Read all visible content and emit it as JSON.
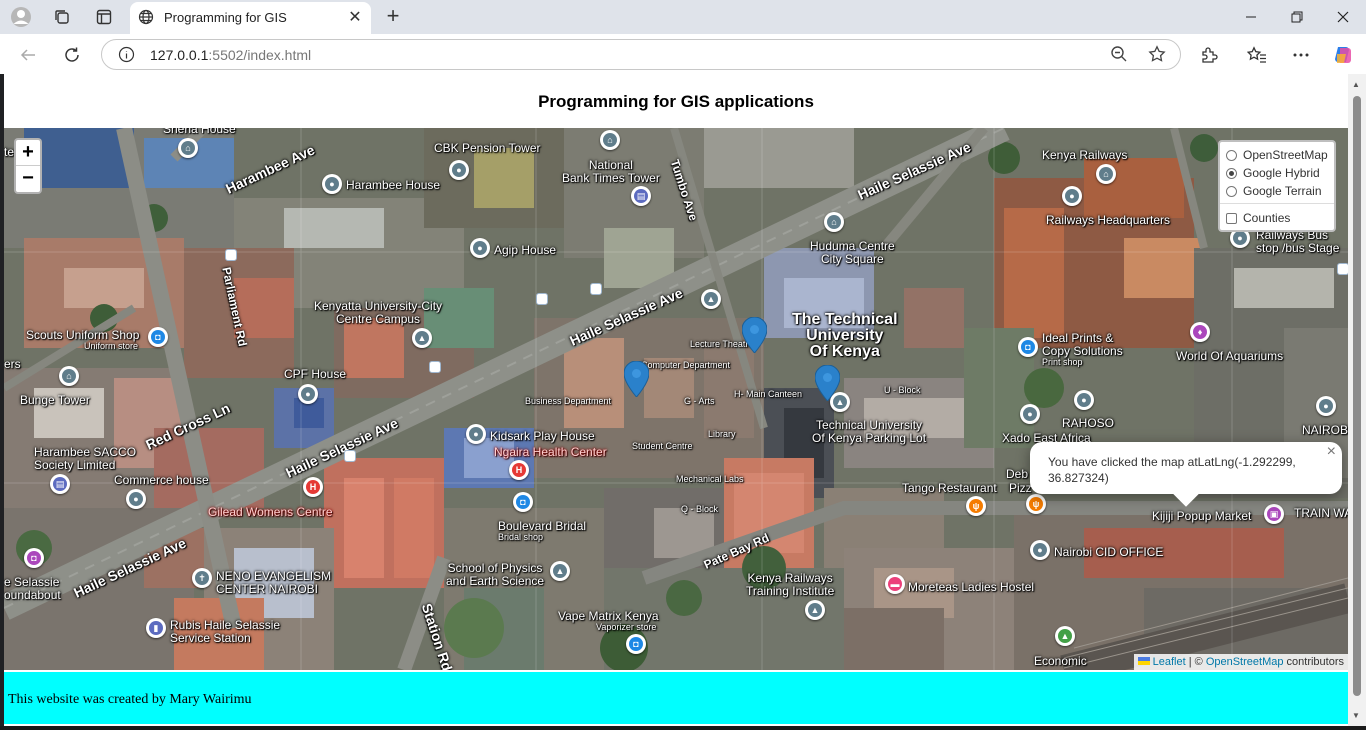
{
  "browser": {
    "tab_title": "Programming for GIS",
    "url_host": "127.0.0.1",
    "url_rest": ":5502/index.html"
  },
  "page": {
    "title": "Programming for GIS applications",
    "footer": "This website was created by Mary Wairimu"
  },
  "map": {
    "zoom_in": "+",
    "zoom_out": "−",
    "layers": {
      "base": [
        "OpenStreetMap",
        "Google Hybrid",
        "Google Terrain"
      ],
      "selected": "Google Hybrid",
      "overlays": [
        "Counties"
      ]
    },
    "popup": {
      "text": "You have clicked the map atLatLng(-1.292299, 36.827324)",
      "close": "×"
    },
    "attribution": {
      "leaflet": "Leaflet",
      "separator": " | © ",
      "osm": "OpenStreetMap",
      "suffix": " contributors"
    },
    "labels": {
      "sheria_house": "Sheria House",
      "cbk_pension": "CBK Pension Tower",
      "tumbo_ave": "Tumbo Ave",
      "national_bank": "National\nBank Times Tower",
      "kenya_railways": "Kenya Railways",
      "haile_selassie_ave_1": "Haile Selassie Ave",
      "harambee_ave": "Harambee Ave",
      "harambee_house": "Harambee House",
      "agip_house": "Agip House",
      "huduma_centre": "Huduma Centre\nCity Square",
      "railways_hq": "Railways Headquarters",
      "railways_bus": "Railways Bus\nstop /bus Stage",
      "parliament_rd": "Parliament Rd",
      "kenyatta_univ": "Kenyatta University-City\nCentre Campus",
      "haile_selassie_ave_2": "Haile Selassie Ave",
      "tuk": "The Technical\nUniversity\nOf Kenya",
      "scouts": "Scouts Uniform Shop",
      "scouts_sub": "Uniform store",
      "lecture_theatre": "Lecture Theatre",
      "ideal_prints": "Ideal Prints &\nCopy Solutions",
      "ideal_prints_sub": "Print shop",
      "world_aquariums": "World Of Aquariums",
      "cpf_house": "CPF House",
      "computer_dept": "Computer Department",
      "bunge_tower": "Bunge Tower",
      "business_dept": "Business Department",
      "g_arts": "G - Arts",
      "main_canteen": "H- Main Canteen",
      "u_block": "U - Block",
      "rahoso": "RAHOSO",
      "nairobi_right": "NAIROBI",
      "red_cross": "Red Cross Ln",
      "haile_selassie_ave_3": "Haile Selassie Ave",
      "kidsark": "Kidsark Play House",
      "library": "Library",
      "tuk_parking": "Technical University\nOf Kenya Parking Lot",
      "xado": "Xado East Africa",
      "harambee_sacco": "Harambee SACCO\nSociety Limited",
      "ngaira": "Ngaira Health Center",
      "student_centre": "Student Centre",
      "commerce_house": "Commerce house",
      "mechanical_labs": "Mechanical Labs",
      "tango": "Tango Restaurant",
      "deb": "Deb",
      "pizz": "Pizz",
      "gilead": "Gilead Womens Centre",
      "boulevard": "Boulevard Bridal",
      "boulevard_sub": "Bridal shop",
      "q_block": "Q - Block",
      "kijiji": "Kijiji Popup Market",
      "train_wa": "TRAIN WA",
      "haile_selassie_ave_4": "Haile Selassie Ave",
      "pate_bay": "Pate Bay Rd",
      "nairobi_cid": "Nairobi CID OFFICE",
      "selassie_roundabout": "e Selassie\noundabout",
      "neno": "NENO EVANGELISM\nCENTER NAIROBI",
      "school_physics": "School of Physics\nand Earth Science",
      "kr_training": "Kenya Railways\nTraining Institute",
      "moreteas": "Moreteas Ladies Hostel",
      "station_rd": "Station Rd",
      "rubis": "Rubis Haile Selassie\nService Station",
      "vape_matrix": "Vape Matrix Kenya",
      "vape_sub": "Vaporizer store",
      "economic": "Economic",
      "tes": "tes",
      "ers": "ers"
    }
  }
}
